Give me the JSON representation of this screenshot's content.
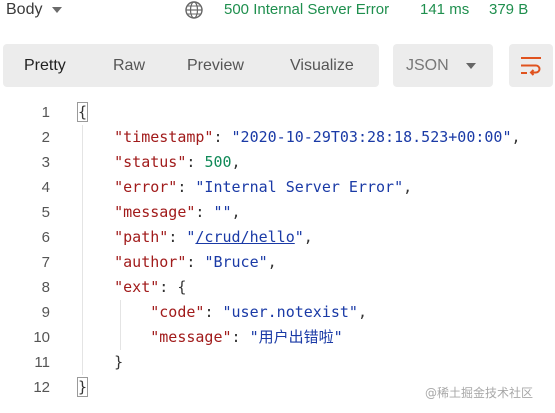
{
  "topbar": {
    "body_label": "Body",
    "status": "500 Internal Server Error",
    "time": "141 ms",
    "size": "379 B",
    "status_color": "#1f8f4e"
  },
  "toolbar": {
    "tabs": [
      "Pretty",
      "Raw",
      "Preview",
      "Visualize"
    ],
    "active_tab": "Pretty",
    "format": "JSON",
    "wrap_icon": "wrap-lines-icon",
    "wrap_icon_color": "#e0531f"
  },
  "code": {
    "line_numbers": [
      "1",
      "2",
      "3",
      "4",
      "5",
      "6",
      "7",
      "8",
      "9",
      "10",
      "11",
      "12"
    ],
    "keys": {
      "timestamp": "\"timestamp\"",
      "status": "\"status\"",
      "error": "\"error\"",
      "message": "\"message\"",
      "path": "\"path\"",
      "author": "\"author\"",
      "ext": "\"ext\"",
      "code": "\"code\"",
      "ext_message": "\"message\""
    },
    "values": {
      "timestamp": "\"2020-10-29T03:28:18.523+00:00\"",
      "status": "500",
      "error": "\"Internal Server Error\"",
      "message": "\"\"",
      "path_open": "\"",
      "path_link": "/crud/hello",
      "path_close": "\"",
      "author": "\"Bruce\"",
      "code": "\"user.notexist\"",
      "ext_message": "\"用户出错啦\""
    },
    "colors": {
      "key": "#a11b1b",
      "string": "#1a3aa6",
      "number": "#118a58"
    }
  },
  "watermark": "@稀土掘金技术社区"
}
